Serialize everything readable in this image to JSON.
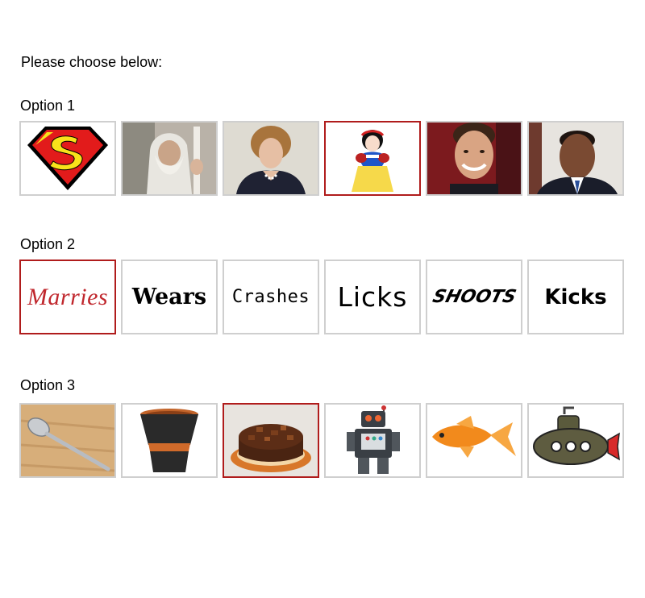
{
  "prompt": "Please choose below:",
  "groups": [
    {
      "label": "Option 1",
      "selected_index": 3,
      "items": [
        "superman-logo",
        "gandalf-photo",
        "thatcher-photo",
        "snow-white",
        "tom-cruise-photo",
        "obama-photo"
      ]
    },
    {
      "label": "Option 2",
      "selected_index": 0,
      "items": [
        "Marries",
        "Wears",
        "Crashes",
        "Licks",
        "SHOOTS",
        "Kicks"
      ]
    },
    {
      "label": "Option 3",
      "selected_index": 2,
      "items": [
        "spoon",
        "flower-pot",
        "chocolate-cake",
        "toy-robot",
        "goldfish",
        "submarine"
      ]
    }
  ],
  "colors": {
    "selected_border": "#b01c1c",
    "tile_border": "#cfcfcf",
    "marries_text": "#c0272d"
  }
}
